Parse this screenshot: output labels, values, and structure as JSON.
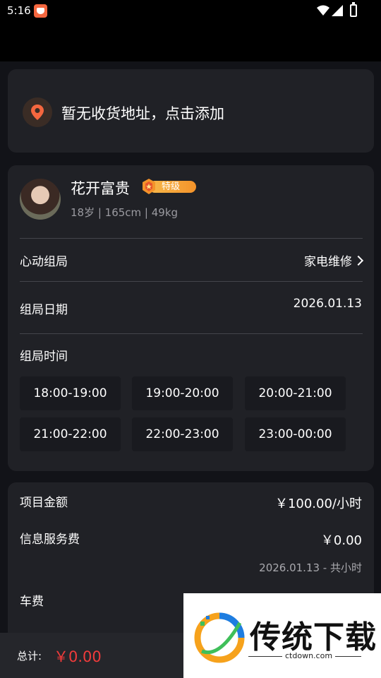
{
  "status_bar": {
    "time": "5:16"
  },
  "address": {
    "text": "暂无收货地址，点击添加"
  },
  "person": {
    "name": "花开富贵",
    "badge": "特级",
    "stats": "18岁 | 165cm | 49kg"
  },
  "rows": {
    "group_label": "心动组局",
    "group_value": "家电维修",
    "date_label": "组局日期",
    "date_value": "2026.01.13",
    "time_label": "组局时间"
  },
  "time_slots": [
    "18:00-19:00",
    "19:00-20:00",
    "20:00-21:00",
    "21:00-22:00",
    "22:00-23:00",
    "23:00-00:00"
  ],
  "price": {
    "item_label": "项目金额",
    "item_value": "￥100.00/小时",
    "service_label": "信息服务费",
    "service_value": "￥0.00",
    "service_note": "2026.01.13 - 共小时",
    "car_label": "车费"
  },
  "bottom": {
    "total_label": "总计:",
    "total_value": "￥0.00"
  },
  "watermark": {
    "title": "传统下载",
    "url": "ctdown.com"
  },
  "colors": {
    "accent_orange": "#f5673f",
    "price_red": "#f03b3b",
    "card_bg": "#202126",
    "page_bg": "#121318"
  }
}
